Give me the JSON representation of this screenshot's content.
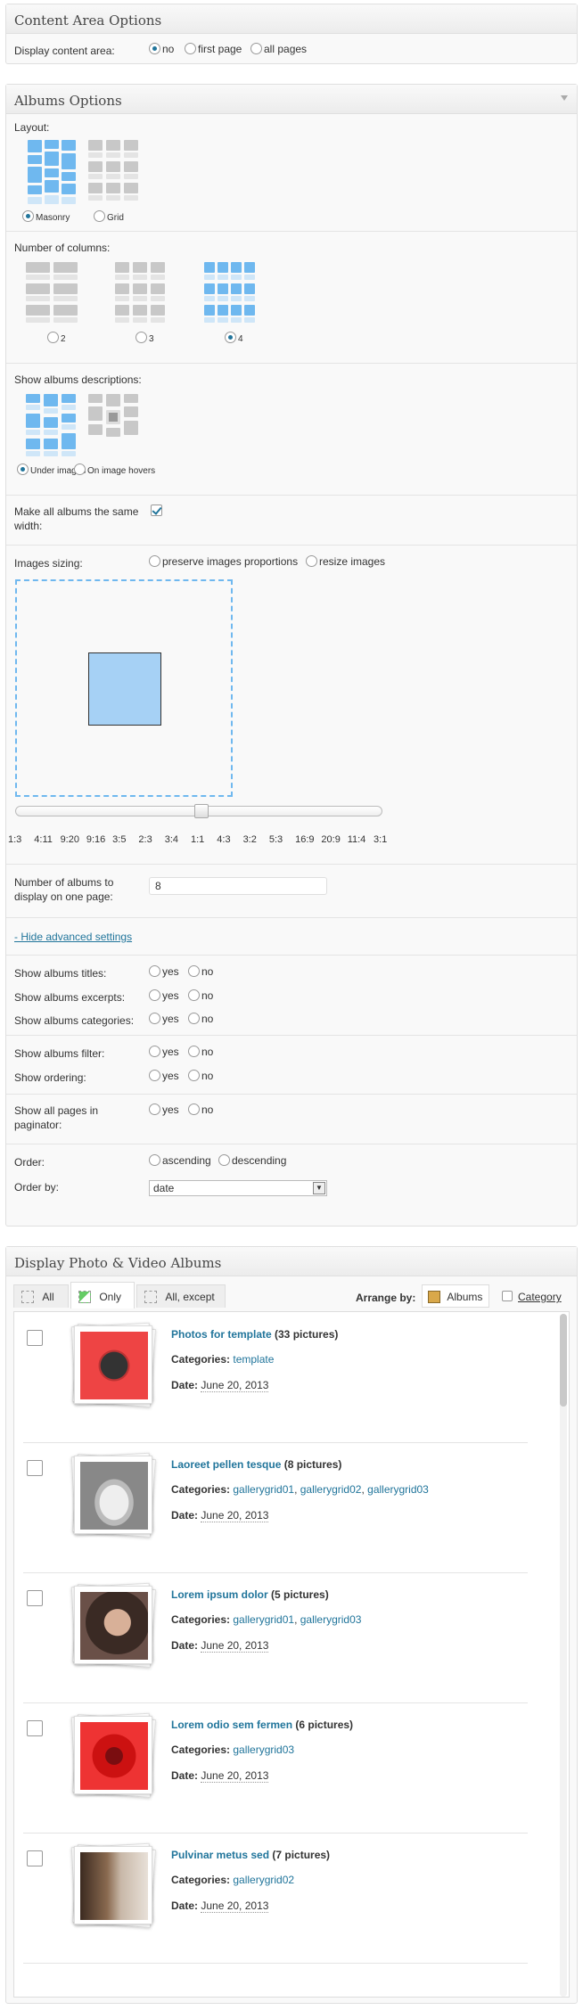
{
  "content_area": {
    "title": "Content Area Options",
    "display_label": "Display content area:",
    "options": [
      "no",
      "first page",
      "all pages"
    ],
    "selected": "no"
  },
  "albums_options": {
    "title": "Albums Options",
    "layout_label": "Layout:",
    "layout_options": [
      "Masonry",
      "Grid"
    ],
    "columns_label": "Number of columns:",
    "columns_options": [
      "2",
      "3",
      "4"
    ],
    "descriptions_label": "Show albums descriptions:",
    "descriptions_options": [
      "Under images",
      "On image hovers"
    ],
    "same_width_label": "Make all albums the same width:",
    "sizing_label": "Images sizing:",
    "sizing_options": [
      "preserve images proportions",
      "resize images"
    ],
    "ratios": [
      "1:3",
      "4:11",
      "9:20",
      "9:16",
      "3:5",
      "2:3",
      "3:4",
      "1:1",
      "4:3",
      "3:2",
      "5:3",
      "16:9",
      "20:9",
      "11:4",
      "3:1"
    ],
    "slider_value": "1:1",
    "per_page_label": "Number of albums to display on one page:",
    "per_page_value": "8",
    "hide_advanced": "- Hide advanced settings",
    "show_titles": "Show albums titles:",
    "show_excerpts": "Show albums excerpts:",
    "show_categories": "Show albums categories:",
    "show_filter": "Show albums filter:",
    "show_ordering": "Show ordering:",
    "show_pages": "Show all pages in paginator:",
    "yes": "yes",
    "no": "no",
    "order_label": "Order:",
    "order_options": [
      "ascending",
      "descending"
    ],
    "order_by_label": "Order by:",
    "order_by_value": "date"
  },
  "display": {
    "title": "Display Photo & Video Albums",
    "tabs": [
      "All",
      "Only",
      "All, except"
    ],
    "arrange_label": "Arrange by:",
    "arrange_albums": "Albums",
    "arrange_category": "Category",
    "albums": [
      {
        "title": "Photos for template",
        "count": "(33 pictures)",
        "categories": [
          "template"
        ],
        "date": "June 20, 2013"
      },
      {
        "title": "Laoreet pellen tesque",
        "count": "(8 pictures)",
        "categories": [
          "gallerygrid01",
          "gallerygrid02",
          "gallerygrid03"
        ],
        "date": "June 20, 2013"
      },
      {
        "title": "Lorem ipsum dolor",
        "count": "(5 pictures)",
        "categories": [
          "gallerygrid01",
          "gallerygrid03"
        ],
        "date": "June 20, 2013"
      },
      {
        "title": "Lorem odio sem fermen",
        "count": "(6 pictures)",
        "categories": [
          "gallerygrid03"
        ],
        "date": "June 20, 2013"
      },
      {
        "title": "Pulvinar metus sed",
        "count": "(7 pictures)",
        "categories": [
          "gallerygrid02"
        ],
        "date": "June 20, 2013"
      }
    ],
    "categories_label": "Categories:",
    "date_label": "Date:",
    "cat_sep": ", "
  }
}
